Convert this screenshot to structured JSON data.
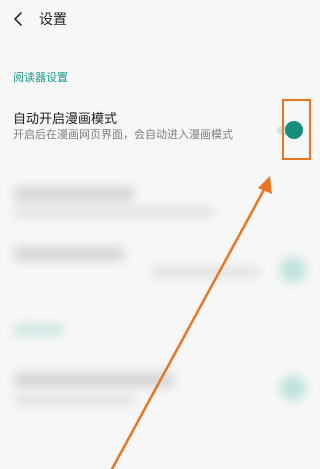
{
  "header": {
    "title": "设置"
  },
  "section": {
    "title": "阅读器设置"
  },
  "setting": {
    "title": "自动开启漫画模式",
    "description": "开启后在漫画网页界面，会自动进入漫画模式",
    "toggle_on": true
  },
  "colors": {
    "accent": "#1a9b8d",
    "toggle_thumb": "#178e7d",
    "annotation": "#e8761e"
  },
  "icons": {
    "back": "chevron-left-icon"
  }
}
